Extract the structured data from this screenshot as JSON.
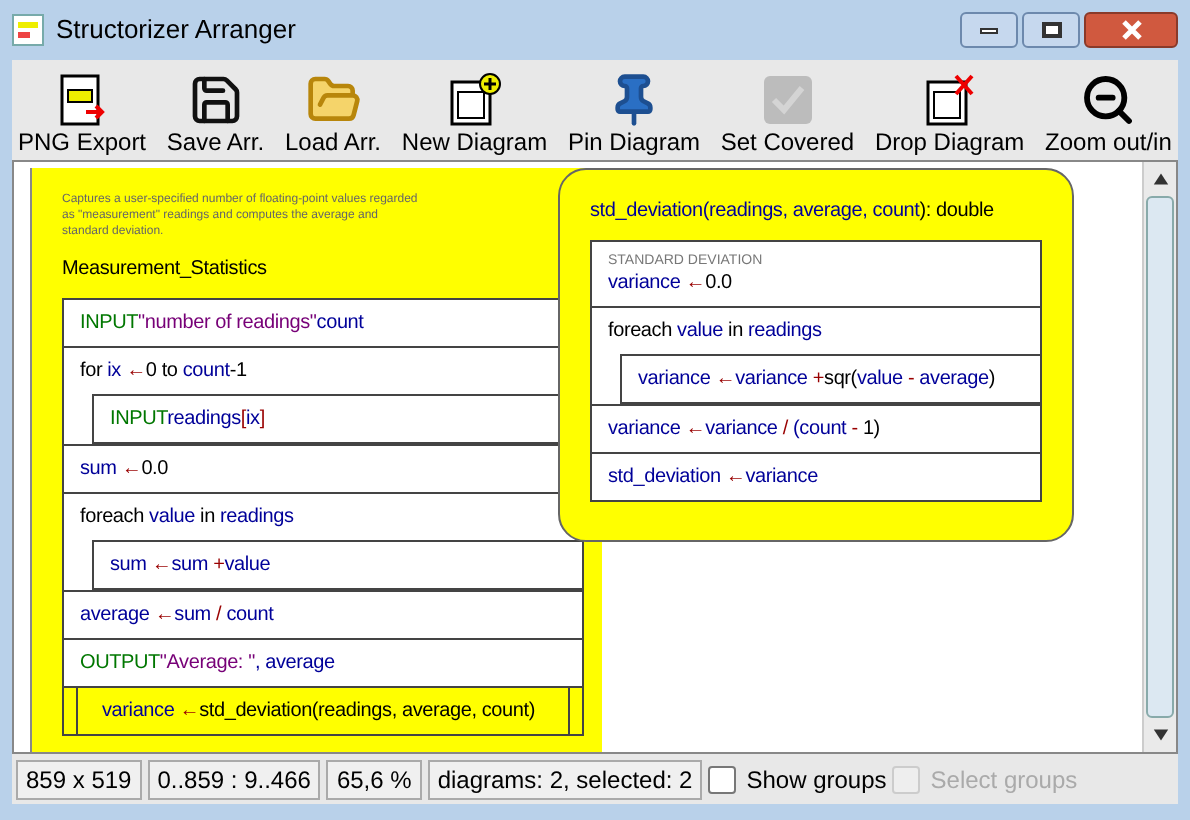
{
  "window": {
    "title": "Structorizer Arranger"
  },
  "toolbar": [
    {
      "label": "PNG Export",
      "disabled": false
    },
    {
      "label": "Save Arr.",
      "disabled": false
    },
    {
      "label": "Load Arr.",
      "disabled": false
    },
    {
      "label": "New Diagram",
      "disabled": false
    },
    {
      "label": "Pin Diagram",
      "disabled": false
    },
    {
      "label": "Set Covered",
      "disabled": true
    },
    {
      "label": "Drop Diagram",
      "disabled": false
    },
    {
      "label": "Zoom out/in",
      "disabled": false
    }
  ],
  "diagrams": [
    {
      "comment": "Captures a user-specified number of floating-point values regarded as \"measurement\" readings and computes the average and standard deviation.",
      "header": [
        {
          "text": "Measurement_Statistics",
          "kind": "plain"
        }
      ],
      "rounded": false,
      "selected": true,
      "elements": [
        {
          "kind": "instruction",
          "tokens": [
            {
              "text": "INPUT",
              "kind": "keyword"
            },
            {
              "text": "\"number of readings\"",
              "kind": "string"
            },
            {
              "text": "count",
              "kind": "variable"
            }
          ]
        },
        {
          "kind": "loop",
          "tokens": [
            {
              "text": "for",
              "kind": "plain"
            },
            {
              "text": " ix ",
              "kind": "variable"
            },
            {
              "text": "←",
              "kind": "operator"
            },
            {
              "text": "0 to ",
              "kind": "plain"
            },
            {
              "text": "count",
              "kind": "variable"
            },
            {
              "text": "-1",
              "kind": "plain"
            }
          ],
          "children": [
            {
              "kind": "instruction",
              "tokens": [
                {
                  "text": "INPUT",
                  "kind": "keyword"
                },
                {
                  "text": "readings",
                  "kind": "variable"
                },
                {
                  "text": "[",
                  "kind": "operator"
                },
                {
                  "text": "ix",
                  "kind": "variable"
                },
                {
                  "text": "]",
                  "kind": "operator"
                }
              ]
            }
          ]
        },
        {
          "kind": "instruction",
          "tokens": [
            {
              "text": "sum ",
              "kind": "variable"
            },
            {
              "text": "←",
              "kind": "operator"
            },
            {
              "text": "0.0",
              "kind": "plain"
            }
          ]
        },
        {
          "kind": "loop",
          "tokens": [
            {
              "text": "foreach ",
              "kind": "plain"
            },
            {
              "text": "value",
              "kind": "variable"
            },
            {
              "text": " in ",
              "kind": "plain"
            },
            {
              "text": "readings",
              "kind": "variable"
            }
          ],
          "children": [
            {
              "kind": "instruction",
              "tokens": [
                {
                  "text": "sum ",
                  "kind": "variable"
                },
                {
                  "text": "←",
                  "kind": "operator"
                },
                {
                  "text": "sum ",
                  "kind": "variable"
                },
                {
                  "text": "+",
                  "kind": "operator"
                },
                {
                  "text": "value",
                  "kind": "variable"
                }
              ]
            }
          ]
        },
        {
          "kind": "instruction",
          "tokens": [
            {
              "text": "average ",
              "kind": "variable"
            },
            {
              "text": "←",
              "kind": "operator"
            },
            {
              "text": "sum ",
              "kind": "variable"
            },
            {
              "text": "/ ",
              "kind": "operator"
            },
            {
              "text": "count",
              "kind": "variable"
            }
          ]
        },
        {
          "kind": "instruction",
          "tokens": [
            {
              "text": "OUTPUT",
              "kind": "keyword"
            },
            {
              "text": "\"Average: \"",
              "kind": "string"
            },
            {
              "text": ", average",
              "kind": "variable"
            }
          ]
        },
        {
          "kind": "call",
          "tokens": [
            {
              "text": "variance ",
              "kind": "variable"
            },
            {
              "text": "←",
              "kind": "operator"
            },
            {
              "text": "std_deviation(readings, average, count)",
              "kind": "plain"
            }
          ]
        }
      ]
    },
    {
      "header": [
        {
          "text": "std_deviation(",
          "kind": "variable"
        },
        {
          "text": "readings, average, count",
          "kind": "variable"
        },
        {
          "text": "): double",
          "kind": "plain"
        }
      ],
      "rounded": true,
      "selected": true,
      "elements": [
        {
          "kind": "instruction",
          "note": "STANDARD DEVIATION",
          "tokens": [
            {
              "text": "variance ",
              "kind": "variable"
            },
            {
              "text": "←",
              "kind": "operator"
            },
            {
              "text": "0.0",
              "kind": "plain"
            }
          ]
        },
        {
          "kind": "loop",
          "tokens": [
            {
              "text": "foreach ",
              "kind": "plain"
            },
            {
              "text": "value",
              "kind": "variable"
            },
            {
              "text": " in ",
              "kind": "plain"
            },
            {
              "text": "readings",
              "kind": "variable"
            }
          ],
          "children": [
            {
              "kind": "instruction",
              "tokens": [
                {
                  "text": "variance ",
                  "kind": "variable"
                },
                {
                  "text": "←",
                  "kind": "operator"
                },
                {
                  "text": "variance ",
                  "kind": "variable"
                },
                {
                  "text": "+",
                  "kind": "operator"
                },
                {
                  "text": "sqr(",
                  "kind": "plain"
                },
                {
                  "text": "value ",
                  "kind": "variable"
                },
                {
                  "text": "- ",
                  "kind": "operator"
                },
                {
                  "text": "average",
                  "kind": "variable"
                },
                {
                  "text": ")",
                  "kind": "plain"
                }
              ]
            }
          ]
        },
        {
          "kind": "instruction",
          "tokens": [
            {
              "text": "variance ",
              "kind": "variable"
            },
            {
              "text": "←",
              "kind": "operator"
            },
            {
              "text": "variance ",
              "kind": "variable"
            },
            {
              "text": "/ ",
              "kind": "operator"
            },
            {
              "text": "(count ",
              "kind": "variable"
            },
            {
              "text": "- ",
              "kind": "operator"
            },
            {
              "text": "1)",
              "kind": "plain"
            }
          ]
        },
        {
          "kind": "instruction",
          "tokens": [
            {
              "text": "std_deviation ",
              "kind": "variable"
            },
            {
              "text": "←",
              "kind": "operator"
            },
            {
              "text": "variance",
              "kind": "variable"
            }
          ]
        }
      ]
    }
  ],
  "status_bar": {
    "cells": [
      "859 x 519",
      "0..859 : 9..466",
      "65,6 %",
      "diagrams: 2, selected: 2"
    ],
    "checkboxes": [
      {
        "label": "Show groups",
        "checked": false,
        "disabled": false
      },
      {
        "label": "Select groups",
        "checked": false,
        "disabled": true
      }
    ]
  }
}
